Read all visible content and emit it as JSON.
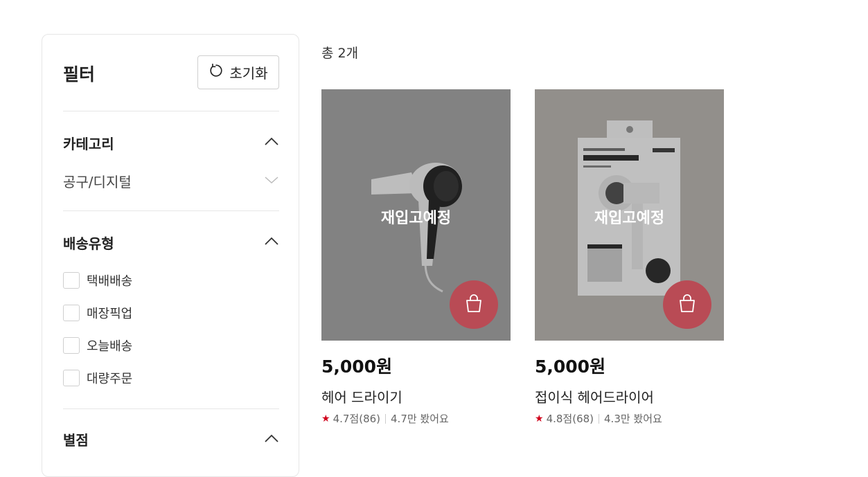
{
  "filter": {
    "title": "필터",
    "reset_label": "초기화",
    "category": {
      "title": "카테고리",
      "value": "공구/디지털"
    },
    "delivery": {
      "title": "배송유형",
      "options": [
        "택배배송",
        "매장픽업",
        "오늘배송",
        "대량주문"
      ]
    },
    "rating": {
      "title": "별점"
    }
  },
  "results": {
    "total_label": "총 2개"
  },
  "products": [
    {
      "status": "재입고예정",
      "price": "5,000원",
      "name": "헤어 드라이기",
      "rating": "4.7점(86)",
      "views": "4.7만 봤어요"
    },
    {
      "status": "재입고예정",
      "price": "5,000원",
      "name": "접이식 헤어드라이어",
      "rating": "4.8점(68)",
      "views": "4.3만 봤어요"
    }
  ],
  "colors": {
    "cart_button": "#b94b55",
    "star": "#d0021b"
  },
  "icons": {
    "reset": "refresh-icon",
    "expand": "chevron-up-icon",
    "collapse": "chevron-down-icon",
    "cart": "shopping-bag-icon",
    "star": "star-icon"
  }
}
